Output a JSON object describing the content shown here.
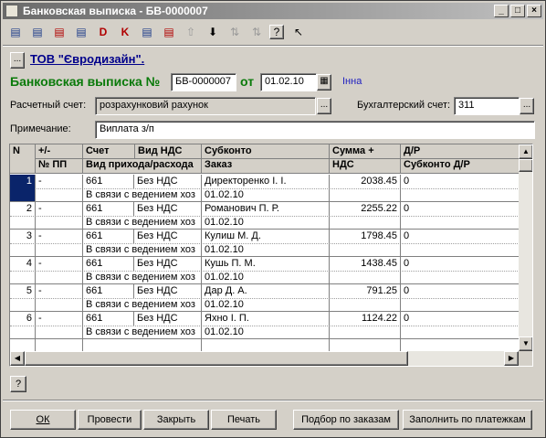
{
  "window": {
    "title": "Банковская выписка - БВ-0000007",
    "minimize_glyph": "_",
    "maximize_glyph": "□",
    "close_glyph": "×"
  },
  "toolbar": {
    "buttons": [
      "new-row",
      "add-row",
      "delete-row",
      "copy-row",
      "dt-entry",
      "kt-entry",
      "edit-row",
      "insert-row",
      "move-up",
      "move-down",
      "sort-asc",
      "sort-desc",
      "help",
      "context-help"
    ],
    "glyphs": {
      "new": "▤",
      "add": "▤",
      "delete": "▤",
      "copy": "▤",
      "dt": "D",
      "kt": "K",
      "edit": "▤",
      "insert": "▤",
      "up": "⇧",
      "down": "⬇",
      "sort_asc": "⇅",
      "sort_desc": "⇅",
      "help": "?",
      "pointer": "↖"
    }
  },
  "header": {
    "org_button": "...",
    "org": "ТОВ \"Євродизайн\".",
    "doc_title": "Банковская выписка №",
    "doc_number": "БВ-0000007",
    "date_label": "от",
    "doc_date": "01.02.10",
    "author": "Інна",
    "account_label": "Расчетный счет:",
    "account_value": "розрахунковий рахунок",
    "ledger_label": "Бухгалтерский счет:",
    "ledger_value": "311",
    "note_label": "Примечание:",
    "note_value": "Виплата з/п",
    "pick_glyph": "...",
    "calendar_glyph": "▦"
  },
  "grid": {
    "headers": [
      {
        "l1": "N",
        "l2": ""
      },
      {
        "l1": "+/-",
        "l2": "№ ПП"
      },
      {
        "l1": "Счет",
        "l2": "Вид прихода/расхода"
      },
      {
        "l1": "Вид НДС",
        "l2": ""
      },
      {
        "l1": "Субконто",
        "l2": "Заказ"
      },
      {
        "l1": "Сумма +",
        "l2": "НДС"
      },
      {
        "l1": "Д/Р",
        "l2": "Субконто Д/Р"
      }
    ],
    "rows": [
      {
        "n": "1",
        "sign": "-",
        "acc": "661",
        "vat": "Без НДС",
        "sub": "Директоренко І. І.",
        "sum": "2038.45",
        "dr": "0",
        "kind": "В связи с ведением хоз",
        "order": "01.02.10"
      },
      {
        "n": "2",
        "sign": "-",
        "acc": "661",
        "vat": "Без НДС",
        "sub": "Романович П. Р.",
        "sum": "2255.22",
        "dr": "0",
        "kind": "В связи с ведением хоз",
        "order": "01.02.10"
      },
      {
        "n": "3",
        "sign": "-",
        "acc": "661",
        "vat": "Без НДС",
        "sub": "Кулиш М. Д.",
        "sum": "1798.45",
        "dr": "0",
        "kind": "В связи с ведением хоз",
        "order": "01.02.10"
      },
      {
        "n": "4",
        "sign": "-",
        "acc": "661",
        "vat": "Без НДС",
        "sub": "Кушь П. М.",
        "sum": "1438.45",
        "dr": "0",
        "kind": "В связи с ведением хоз",
        "order": "01.02.10"
      },
      {
        "n": "5",
        "sign": "-",
        "acc": "661",
        "vat": "Без НДС",
        "sub": "Дар Д. А.",
        "sum": "791.25",
        "dr": "0",
        "kind": "В связи с ведением хоз",
        "order": "01.02.10"
      },
      {
        "n": "6",
        "sign": "-",
        "acc": "661",
        "vat": "Без НДС",
        "sub": "Яхно І. П.",
        "sum": "1124.22",
        "dr": "0",
        "kind": "В связи с ведением хоз",
        "order": "01.02.10"
      }
    ],
    "scroll_up": "▲",
    "scroll_down": "▼",
    "scroll_left": "◀",
    "scroll_right": "▶"
  },
  "footer": {
    "help": "?",
    "ok": "ОК",
    "post": "Провести",
    "close": "Закрыть",
    "print": "Печать",
    "pick_orders": "Подбор по заказам",
    "fill_payments": "Заполнить по платежкам"
  }
}
